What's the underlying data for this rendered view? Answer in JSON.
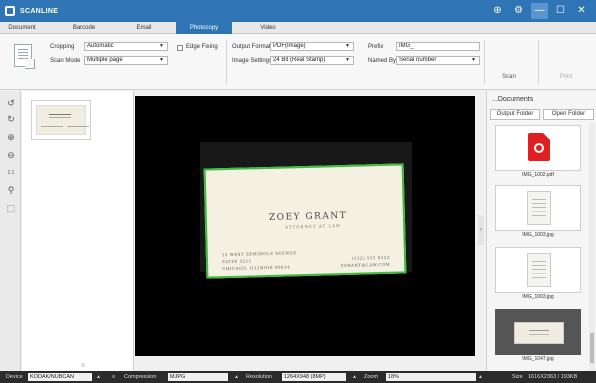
{
  "app": {
    "title": "SCANLINE",
    "colors": {
      "titlebar": "#2f75b5",
      "active_tab": "#2f75b5",
      "selection_outline": "#3dbd3d"
    },
    "window_controls": [
      {
        "name": "globe-icon",
        "glyph": "⊕"
      },
      {
        "name": "settings-icon",
        "glyph": "⚙"
      },
      {
        "name": "minimize-icon",
        "glyph": "—"
      },
      {
        "name": "maximize-icon",
        "glyph": "☐"
      },
      {
        "name": "close-icon",
        "glyph": "✕"
      }
    ]
  },
  "tabs": [
    "Document",
    "Barcode",
    "Email",
    "Photocopy",
    "Video"
  ],
  "active_tab_index": 3,
  "toolbar": {
    "cropping_label": "Cropping",
    "cropping_value": "Automatic",
    "scan_mode_label": "Scan Mode",
    "scan_mode_value": "Multiple page",
    "edge_fixing_label": "Edge Fixing",
    "output_format_label": "Output Format",
    "output_format_value": "PDF(Image)",
    "image_settings_label": "Image Settings",
    "image_settings_value": "24 Bit (Real Stamp)",
    "prefix_label": "Prefix",
    "prefix_value": "IMG_",
    "named_by_label": "Named By",
    "named_by_value": "Serial number",
    "scan_button": "Scan",
    "print_button": "Print"
  },
  "tools": [
    {
      "name": "rotate-left-icon",
      "glyph": "↺"
    },
    {
      "name": "rotate-right-icon",
      "glyph": "↻"
    },
    {
      "name": "zoom-in-icon",
      "glyph": "⊕"
    },
    {
      "name": "zoom-out-icon",
      "glyph": "⊖"
    },
    {
      "name": "fit-to-window-icon",
      "glyph": "1:1"
    },
    {
      "name": "stamp-icon",
      "glyph": "⚲"
    },
    {
      "name": "crop-icon",
      "glyph": "⬚"
    }
  ],
  "card": {
    "name": "ZOEY GRANT",
    "title": "ATTORNEY AT LAW",
    "address_line1": "12 WEST SEMINOLE AVENUE",
    "address_line2": "SUITE 3211",
    "address_line3": "CHICAGO, ILLINOIS 60614",
    "phone": "(312) 555 0123",
    "email": "ZGRANT@LAW.COM"
  },
  "right_panel": {
    "folder_path": "...Documents",
    "output_folder_button": "Output Folder",
    "open_folder_button": "Open Folder",
    "files": [
      {
        "name": "IMG_1002.pdf",
        "kind": "pdf"
      },
      {
        "name": "IMG_1003.jpg",
        "kind": "page"
      },
      {
        "name": "IMG_1003.jpg",
        "kind": "page"
      },
      {
        "name": "IMG_1047.jpg",
        "kind": "card",
        "selected": true
      }
    ]
  },
  "statusbar": {
    "device_label": "Device",
    "device_value": "KODAK/NUBCAN",
    "compression_label": "Compression",
    "compression_value": "MJPG",
    "resolution_label": "Resolution",
    "resolution_value": "1264X948 (8MP)",
    "zoom_label": "Zoom",
    "zoom_value": "18%",
    "size_label": "Size",
    "size_value": "1616X2363 / 193KB"
  }
}
